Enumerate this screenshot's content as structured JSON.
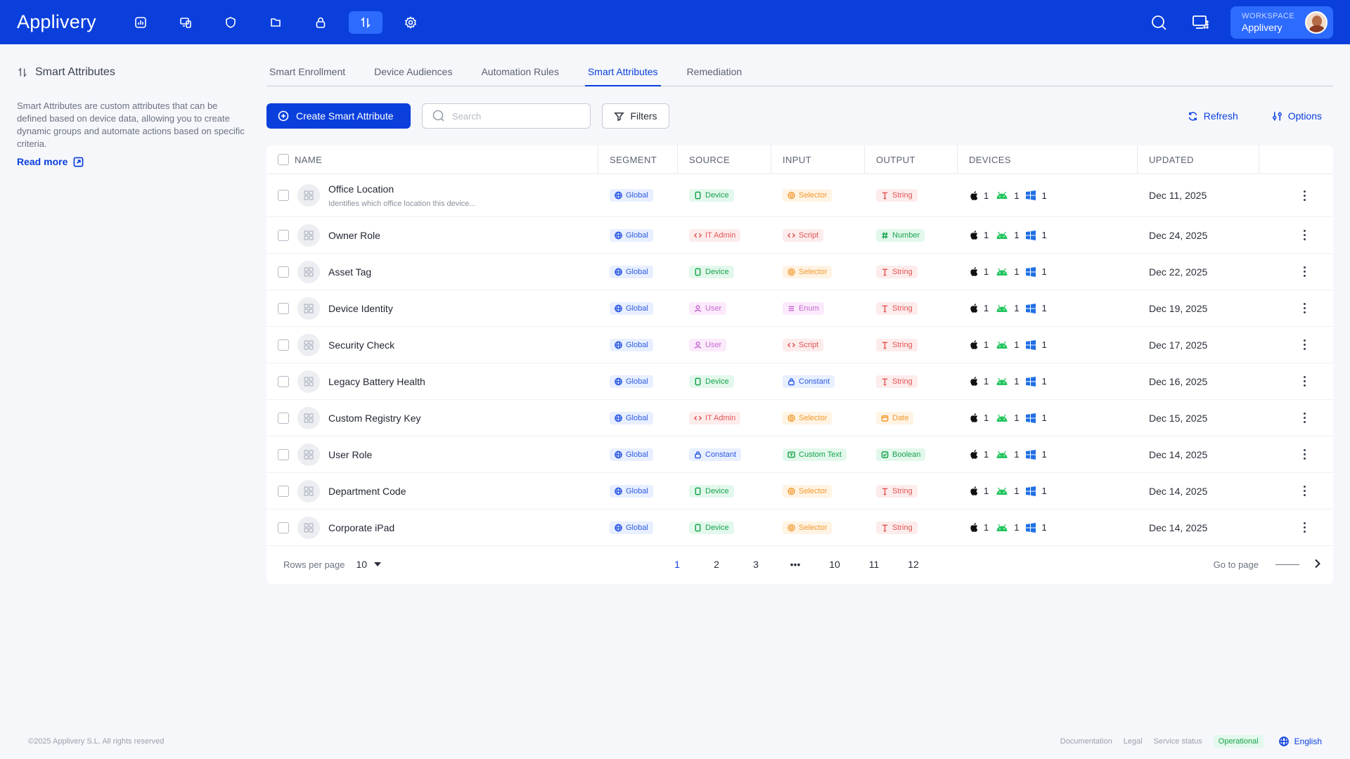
{
  "app": {
    "logo": "Applivery"
  },
  "workspace": {
    "label": "WORKSPACE",
    "name": "Applivery"
  },
  "left": {
    "title": "Smart Attributes",
    "description": "Smart Attributes are custom attributes that can be defined based on device data, allowing you to create dynamic groups and automate actions based on specific criteria.",
    "read_more": "Read more"
  },
  "tabs": [
    "Smart Enrollment",
    "Device Audiences",
    "Automation Rules",
    "Smart Attributes",
    "Remediation"
  ],
  "toolbar": {
    "create_label": "Create Smart Attribute",
    "search_placeholder": "Search",
    "filters_label": "Filters",
    "refresh_label": "Refresh",
    "options_label": "Options"
  },
  "table": {
    "headers": [
      "NAME",
      "SEGMENT",
      "SOURCE",
      "INPUT",
      "OUTPUT",
      "DEVICES",
      "UPDATED"
    ],
    "rows": [
      {
        "name": "Office Location",
        "desc": "Identifies which office location this device...",
        "segment": "Global",
        "source": "Device",
        "input": "Selector",
        "output": "String",
        "ios": "1",
        "android": "1",
        "windows": "1",
        "updated": "Dec 11, 2025"
      },
      {
        "name": "Owner Role",
        "desc": "",
        "segment": "Global",
        "source": "IT Admin",
        "input": "Script",
        "output": "Number",
        "ios": "1",
        "android": "1",
        "windows": "1",
        "updated": "Dec 24, 2025"
      },
      {
        "name": "Asset Tag",
        "desc": "",
        "segment": "Global",
        "source": "Device",
        "input": "Selector",
        "output": "String",
        "ios": "1",
        "android": "1",
        "windows": "1",
        "updated": "Dec 22, 2025"
      },
      {
        "name": "Device Identity",
        "desc": "",
        "segment": "Global",
        "source": "User",
        "input": "Enum",
        "output": "String",
        "ios": "1",
        "android": "1",
        "windows": "1",
        "updated": "Dec 19, 2025"
      },
      {
        "name": "Security Check",
        "desc": "",
        "segment": "Global",
        "source": "User",
        "input": "Script",
        "output": "String",
        "ios": "1",
        "android": "1",
        "windows": "1",
        "updated": "Dec 17, 2025"
      },
      {
        "name": "Legacy Battery Health",
        "desc": "",
        "segment": "Global",
        "source": "Device",
        "input": "Constant",
        "output": "String",
        "ios": "1",
        "android": "1",
        "windows": "1",
        "updated": "Dec 16, 2025"
      },
      {
        "name": "Custom Registry Key",
        "desc": "",
        "segment": "Global",
        "source": "IT Admin",
        "input": "Selector",
        "output": "Date",
        "ios": "1",
        "android": "1",
        "windows": "1",
        "updated": "Dec 15, 2025"
      },
      {
        "name": "User Role",
        "desc": "",
        "segment": "Global",
        "source": "Constant",
        "input": "Custom Text",
        "output": "Boolean",
        "ios": "1",
        "android": "1",
        "windows": "1",
        "updated": "Dec 14, 2025"
      },
      {
        "name": "Department Code",
        "desc": "",
        "segment": "Global",
        "source": "Device",
        "input": "Selector",
        "output": "String",
        "ios": "1",
        "android": "1",
        "windows": "1",
        "updated": "Dec 14, 2025"
      },
      {
        "name": "Corporate iPad",
        "desc": "",
        "segment": "Global",
        "source": "Device",
        "input": "Selector",
        "output": "String",
        "ios": "1",
        "android": "1",
        "windows": "1",
        "updated": "Dec 14, 2025"
      }
    ]
  },
  "badge_styles": {
    "Global": {
      "bg": "#e8efff",
      "fg": "#2d5be3",
      "icon": "globe-icon"
    },
    "Device": {
      "bg": "#e3f8ec",
      "fg": "#16a34a",
      "icon": "device-icon"
    },
    "IT Admin": {
      "bg": "#fdecec",
      "fg": "#e25555",
      "icon": "code-icon"
    },
    "User": {
      "bg": "#fbeafb",
      "fg": "#c66ad3",
      "icon": "user-icon"
    },
    "Constant": {
      "bg": "#e8efff",
      "fg": "#2d5be3",
      "icon": "lock-icon"
    },
    "Selector": {
      "bg": "#fff3e3",
      "fg": "#f29a2e",
      "icon": "target-icon"
    },
    "Script": {
      "bg": "#fdecec",
      "fg": "#e25555",
      "icon": "code-icon"
    },
    "Enum": {
      "bg": "#fbeafb",
      "fg": "#c66ad3",
      "icon": "list-icon"
    },
    "Custom Text": {
      "bg": "#e3f8ec",
      "fg": "#16a34a",
      "icon": "text-icon"
    },
    "String": {
      "bg": "#fdecec",
      "fg": "#e25555",
      "icon": "text-t-icon"
    },
    "Number": {
      "bg": "#e3f8ec",
      "fg": "#16a34a",
      "icon": "hash-icon"
    },
    "Date": {
      "bg": "#fff3e3",
      "fg": "#f29a2e",
      "icon": "calendar-icon"
    },
    "Boolean": {
      "bg": "#e3f8ec",
      "fg": "#16a34a",
      "icon": "check-icon"
    }
  },
  "pagination": {
    "rows_label": "Rows per page",
    "rows_value": "10",
    "pages": [
      "1",
      "2",
      "3",
      "•••",
      "10",
      "11",
      "12"
    ],
    "current": "1",
    "goto_label": "Go to page"
  },
  "footer": {
    "copyright": "©2025 Applivery S.L. All rights reserved",
    "documentation": "Documentation",
    "legal": "Legal",
    "service_status": "Service status",
    "status": "Operational",
    "language": "English"
  },
  "colors": {
    "brand": "#0a3fdc",
    "brand_active": "#2d6bff",
    "android": "#22c55e",
    "windows": "#1f6fe5"
  }
}
